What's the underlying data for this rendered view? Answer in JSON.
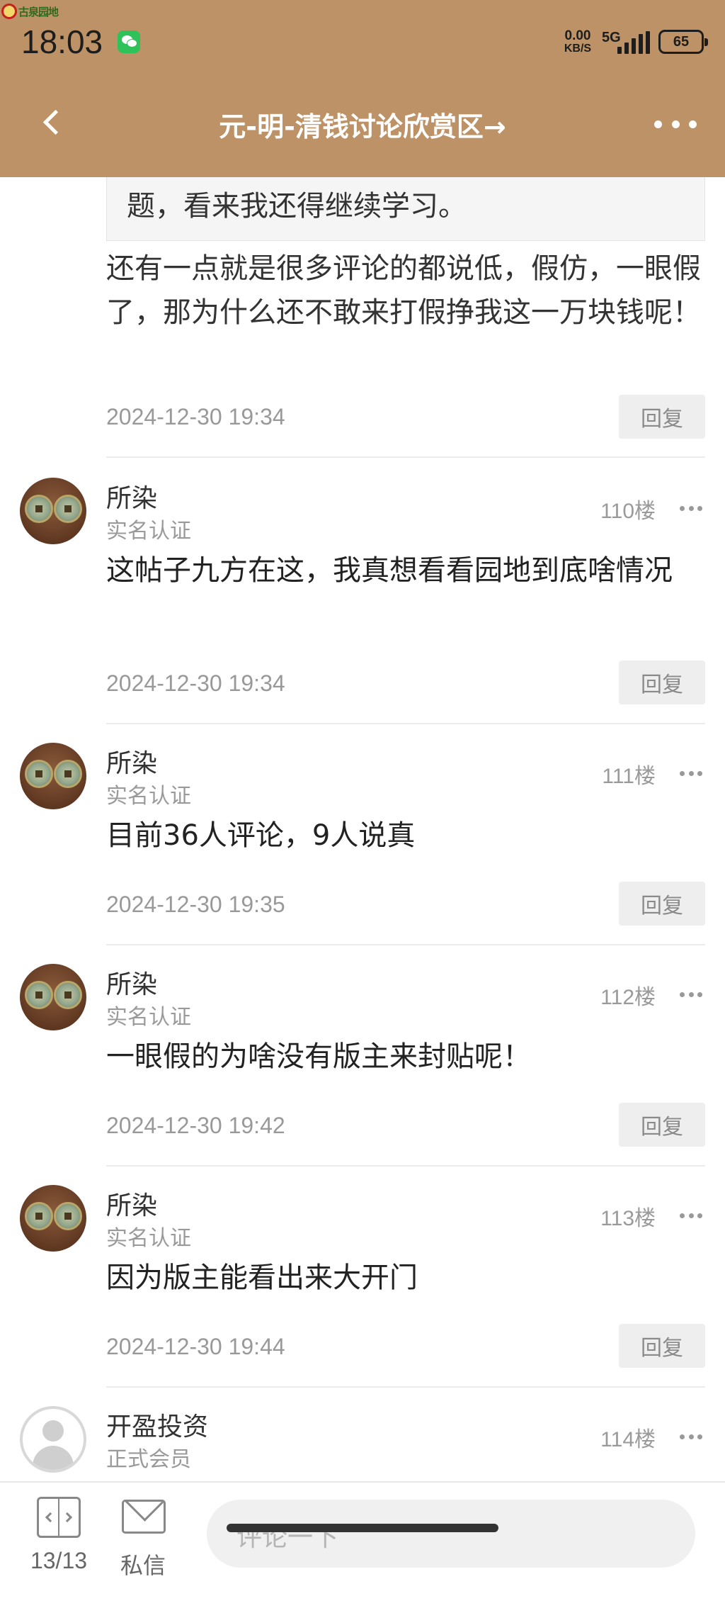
{
  "status_bar": {
    "logo_text": "古泉园地",
    "time": "18:03",
    "net_speed_value": "0.00",
    "net_speed_unit": "KB/S",
    "network": "5G",
    "battery": "65"
  },
  "header": {
    "title": "元-明-清钱讨论欣赏区→"
  },
  "top_post": {
    "quote_text": "题，看来我还得继续学习。",
    "text": "还有一点就是很多评论的都说低，假仿，一眼假了，那为什么还不敢来打假挣我这一万块钱呢！",
    "date": "2024-12-30 19:34",
    "reply_label": "回复"
  },
  "posts": [
    {
      "username": "所染",
      "role": "实名认证",
      "floor": "110楼",
      "text": "这帖子九方在这，我真想看看园地到底啥情况",
      "date": "2024-12-30 19:34",
      "reply_label": "回复"
    },
    {
      "username": "所染",
      "role": "实名认证",
      "floor": "111楼",
      "text": "目前36人评论，9人说真",
      "date": "2024-12-30 19:35",
      "reply_label": "回复"
    },
    {
      "username": "所染",
      "role": "实名认证",
      "floor": "112楼",
      "text": "一眼假的为啥没有版主来封贴呢！",
      "date": "2024-12-30 19:42",
      "reply_label": "回复"
    },
    {
      "username": "所染",
      "role": "实名认证",
      "floor": "113楼",
      "text": "因为版主能看出来大开门",
      "date": "2024-12-30 19:44",
      "reply_label": "回复"
    },
    {
      "username": "开盈投资",
      "role": "正式会员",
      "floor": "114楼"
    }
  ],
  "bottom_bar": {
    "page_label": "13/13",
    "message_label": "私信",
    "comment_placeholder": "评论一下"
  },
  "colors": {
    "header_bg": "#bc9266",
    "reply_bg": "#eeeeee",
    "muted_text": "#999999"
  },
  "icons": {
    "back": "chevron-left-icon",
    "more": "more-dots-icon",
    "page": "page-switch-icon",
    "message": "mail-icon",
    "signal": "signal-icon",
    "battery": "battery-icon",
    "wechat": "wechat-icon"
  }
}
